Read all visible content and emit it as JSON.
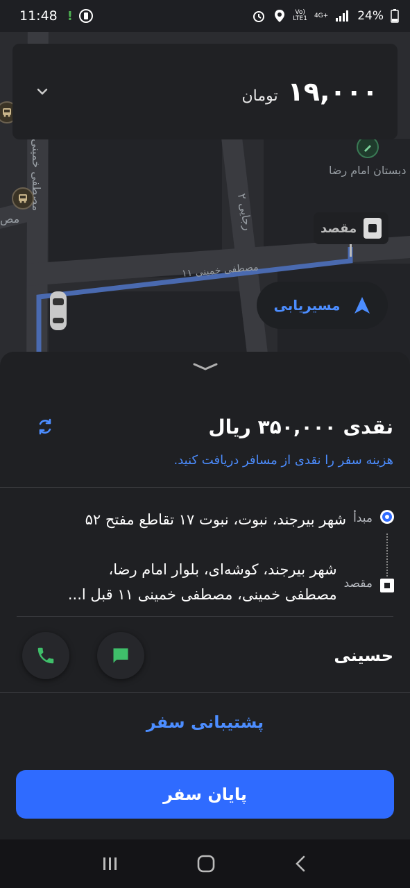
{
  "status_bar": {
    "time": "11:48",
    "alert": "!",
    "network_top": "Vo)",
    "network_bottom": "LTE1",
    "net_type": "4G+",
    "battery": "24%"
  },
  "fare_card": {
    "amount": "۱۹,۰۰۰",
    "unit": "تومان"
  },
  "map": {
    "labels": {
      "school": "دبستان امام رضا",
      "street_side": "مصطفی خمینی",
      "alley": "رجایی ۲",
      "route_street": "مصطفی خمینی ۱۱",
      "left_edge": "مص"
    },
    "destination_chip": "مقصد",
    "navigate_button": "مسیریابی"
  },
  "payment": {
    "title": "نقدی ۳۵۰,۰۰۰ ریال",
    "hint": "هزینه سفر را نقدی از مسافر دریافت کنید."
  },
  "trip": {
    "origin_label": "مبدأ",
    "origin_address": "شهر بیرجند، نبوت، نبوت ۱۷ تقاطع مفتح ۵۲",
    "destination_label": "مقصد",
    "destination_address_line1": "شهر بیرجند، کوشه‌ای، بلوار امام رضا،",
    "destination_address_line2": "مصطفی خمینی، مصطفی خمینی ۱۱ قبل ا..."
  },
  "passenger": {
    "name": "حسینی"
  },
  "actions": {
    "support": "پشتیبانی سفر",
    "end_trip": "پایان سفر"
  },
  "colors": {
    "accent": "#2f6bff",
    "link": "#4c8dff",
    "call_green": "#3fbf6a",
    "background": "#1f2023"
  }
}
